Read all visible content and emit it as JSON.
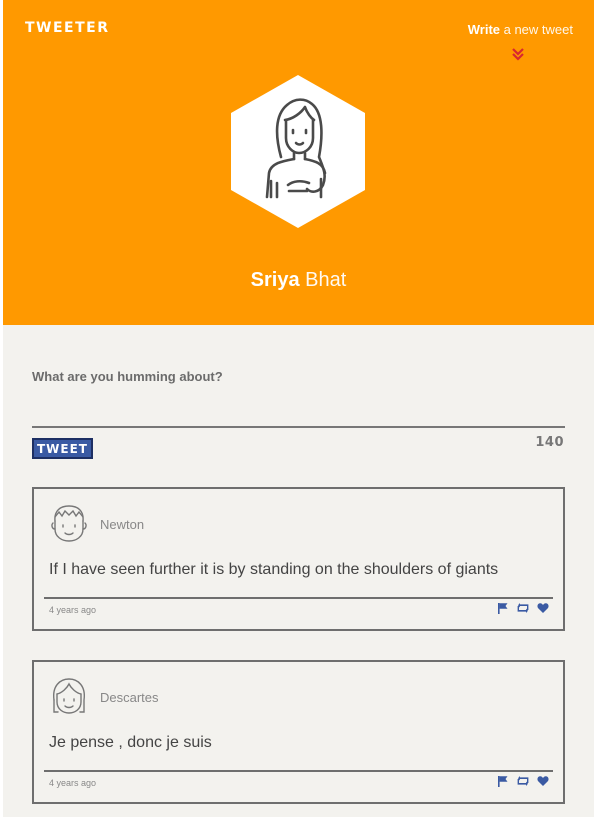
{
  "header": {
    "brand": "TWEETER",
    "write_bold": "Write",
    "write_rest": " a new tweet",
    "chevron_icon": "double-chevron-down-icon",
    "avatar_icon": "girl-avatar-icon",
    "first_name": "Sriya",
    "last_name": " Bhat",
    "accent_color": "#ff9900"
  },
  "compose": {
    "label": "What are you humming about?",
    "placeholder": "",
    "button_label": "TWEET",
    "counter": "140",
    "button_color": "#3a5aa3"
  },
  "tweets": [
    {
      "author": "Newton",
      "avatar_icon": "boy-avatar-icon",
      "text": "If I have seen further it is by standing on the shoulders of giants",
      "time": "4 years ago",
      "actions": [
        "flag-icon",
        "retweet-icon",
        "heart-icon"
      ]
    },
    {
      "author": "Descartes",
      "avatar_icon": "girl-bangs-avatar-icon",
      "text": "Je pense , donc je suis",
      "time": "4 years ago",
      "actions": [
        "flag-icon",
        "retweet-icon",
        "heart-icon"
      ]
    }
  ]
}
